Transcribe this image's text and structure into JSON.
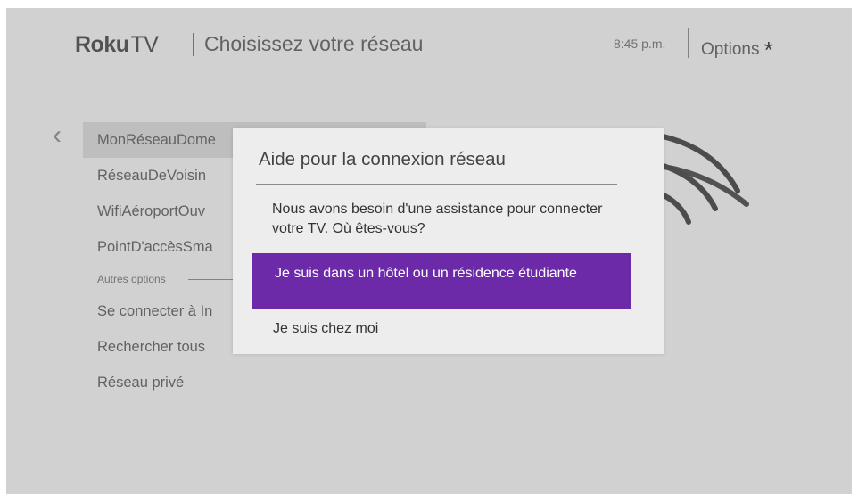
{
  "header": {
    "brand": "Roku",
    "brand_tv": "TV",
    "title": "Choisissez votre réseau",
    "time": "8:45 p.m.",
    "options_label": "Options",
    "options_icon": "*"
  },
  "back_icon": "‹",
  "network_list": [
    "MonRéseauDome",
    "RéseauDeVoisin",
    "WifiAéroportOuv",
    "PointD'accèsSma"
  ],
  "other_options_label": "Autres options",
  "other_options": [
    "Se connecter à In",
    "Rechercher tous",
    "Réseau privé"
  ],
  "dialog": {
    "title": "Aide pour la connexion réseau",
    "message": "Nous avons besoin d'une assistance pour connecter votre TV. Où êtes-vous?",
    "option_hotel": "Je suis dans un hôtel ou un résidence étudiante",
    "option_home": "Je suis chez moi"
  },
  "colors": {
    "accent": "#6c2aa8",
    "background": "#d8d8d8",
    "dialog_bg": "#ededed"
  }
}
